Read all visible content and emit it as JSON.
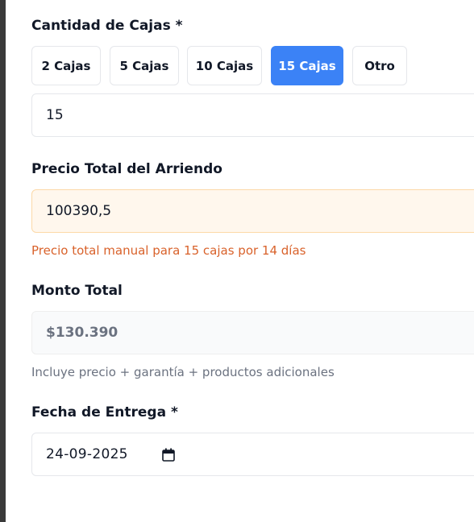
{
  "cantidad": {
    "label": "Cantidad de Cajas *",
    "options": [
      {
        "label": "2 Cajas",
        "selected": false
      },
      {
        "label": "5 Cajas",
        "selected": false
      },
      {
        "label": "10 Cajas",
        "selected": false
      },
      {
        "label": "15 Cajas",
        "selected": true
      },
      {
        "label": "Otro",
        "selected": false
      }
    ],
    "value": "15"
  },
  "precio": {
    "label": "Precio Total del Arriendo",
    "value": "100390,5",
    "note": "Precio total manual para 15 cajas por 14 días"
  },
  "monto": {
    "label": "Monto Total",
    "value": "$130.390",
    "note": "Incluye precio + garantía + productos adicionales"
  },
  "fecha": {
    "label": "Fecha de Entrega *",
    "value": "24-09-2025",
    "icon": "calendar-icon"
  },
  "colors": {
    "accent": "#3b82f6",
    "warning_bg": "#fff7ed",
    "warning_text": "#d9622b"
  }
}
